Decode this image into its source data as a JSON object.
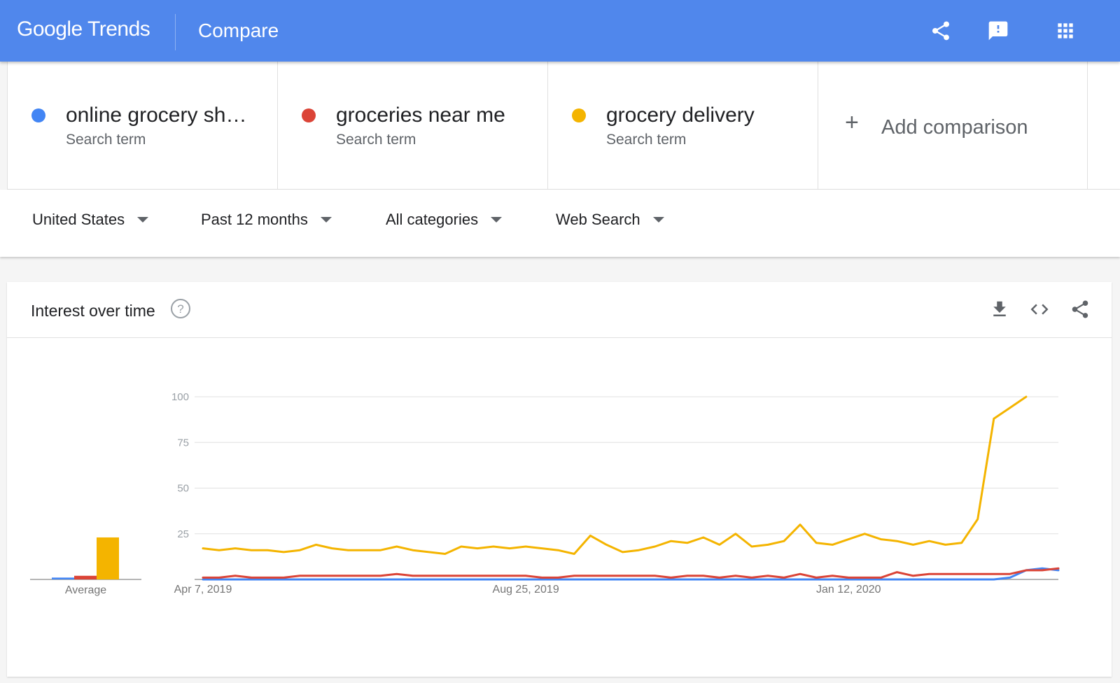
{
  "header": {
    "logo_text": "Google Trends",
    "page_label": "Compare",
    "icons": [
      "share-icon",
      "feedback-icon",
      "apps-icon"
    ]
  },
  "terms": [
    {
      "name": "online grocery sh…",
      "type": "Search term",
      "color": "#4285f4"
    },
    {
      "name": "groceries near me",
      "type": "Search term",
      "color": "#db4437"
    },
    {
      "name": "grocery delivery",
      "type": "Search term",
      "color": "#f4b400"
    }
  ],
  "add_comparison": {
    "plus": "+",
    "label": "Add comparison"
  },
  "filters": {
    "region": "United States",
    "time": "Past 12 months",
    "category": "All categories",
    "property": "Web Search"
  },
  "interest_card": {
    "title": "Interest over time",
    "help_icon": "?",
    "tools": [
      "download-icon",
      "embed-code-icon",
      "share-icon"
    ]
  },
  "chart_data": {
    "type": "line",
    "title": "Interest over time",
    "ylim": [
      0,
      100
    ],
    "y_ticks": [
      25,
      50,
      75,
      100
    ],
    "x_tick_labels": [
      {
        "label": "Apr 7, 2019",
        "index": 0
      },
      {
        "label": "Aug 25, 2019",
        "index": 20
      },
      {
        "label": "Jan 12, 2020",
        "index": 40
      }
    ],
    "grid": true,
    "average_label": "Average",
    "series": [
      {
        "name": "online grocery sh…",
        "color": "#4285f4",
        "average": 1,
        "values": [
          0,
          0,
          0,
          0,
          0,
          0,
          0,
          0,
          0,
          0,
          0,
          0,
          0,
          0,
          0,
          0,
          0,
          0,
          0,
          0,
          0,
          0,
          0,
          0,
          0,
          0,
          0,
          0,
          0,
          0,
          0,
          0,
          0,
          0,
          0,
          0,
          0,
          0,
          0,
          0,
          0,
          0,
          0,
          0,
          0,
          0,
          0,
          0,
          0,
          0,
          1,
          5,
          6,
          5
        ]
      },
      {
        "name": "groceries near me",
        "color": "#db4437",
        "average": 2,
        "values": [
          1,
          1,
          2,
          1,
          1,
          1,
          2,
          2,
          2,
          2,
          2,
          2,
          3,
          2,
          2,
          2,
          2,
          2,
          2,
          2,
          2,
          1,
          1,
          2,
          2,
          2,
          2,
          2,
          2,
          1,
          2,
          2,
          1,
          2,
          1,
          2,
          1,
          3,
          1,
          2,
          1,
          1,
          1,
          4,
          2,
          3,
          3,
          3,
          3,
          3,
          3,
          5,
          5,
          6
        ]
      },
      {
        "name": "grocery delivery",
        "color": "#f4b400",
        "average": 23,
        "values": [
          17,
          16,
          17,
          16,
          16,
          15,
          16,
          19,
          17,
          16,
          16,
          16,
          18,
          16,
          15,
          14,
          18,
          17,
          18,
          17,
          18,
          17,
          16,
          14,
          24,
          19,
          15,
          16,
          18,
          21,
          20,
          23,
          19,
          25,
          18,
          19,
          21,
          30,
          20,
          19,
          22,
          25,
          22,
          21,
          19,
          21,
          19,
          20,
          33,
          88,
          94,
          100
        ]
      }
    ]
  }
}
